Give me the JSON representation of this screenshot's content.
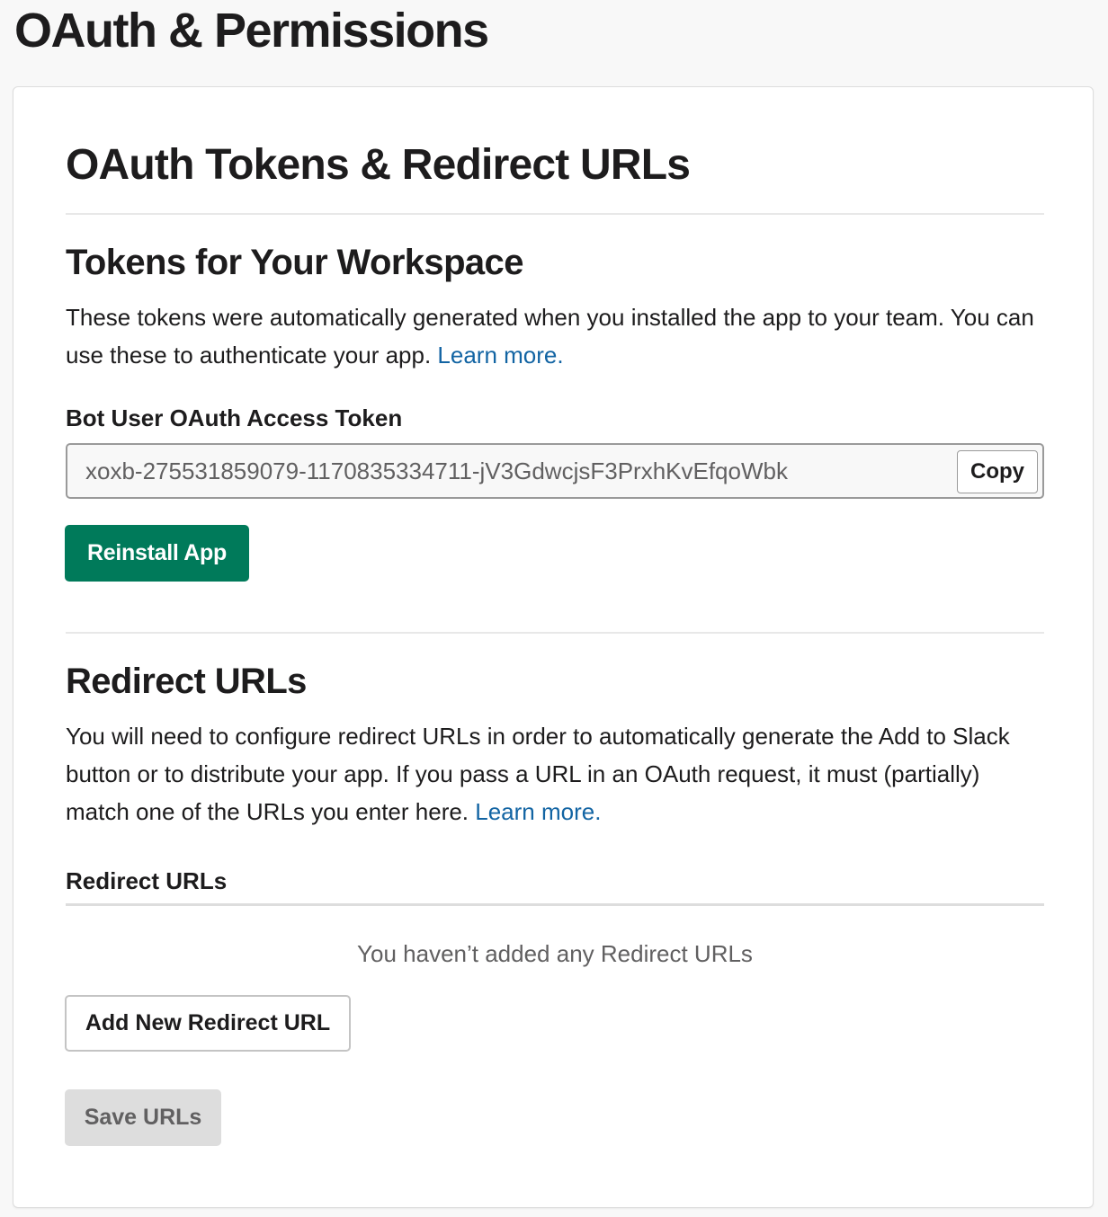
{
  "page": {
    "title": "OAuth & Permissions"
  },
  "oauth_section": {
    "title": "OAuth Tokens & Redirect URLs"
  },
  "tokens": {
    "title": "Tokens for Your Workspace",
    "description": "These tokens were automatically generated when you installed the app to your team. You can use these to authenticate your app.",
    "learn_more": "Learn more.",
    "bot_token_label": "Bot User OAuth Access Token",
    "bot_token_value": "xoxb-275531859079-1170835334711-jV3GdwcjsF3PrxhKvEfqoWbk",
    "copy_label": "Copy",
    "reinstall_label": "Reinstall App"
  },
  "redirects": {
    "title": "Redirect URLs",
    "description": "You will need to configure redirect URLs in order to automatically generate the Add to Slack button or to distribute your app. If you pass a URL in an OAuth request, it must (partially) match one of the URLs you enter here.",
    "learn_more": "Learn more.",
    "list_label": "Redirect URLs",
    "empty_text": "You haven’t added any Redirect URLs",
    "add_label": "Add New Redirect URL",
    "save_label": "Save URLs"
  },
  "colors": {
    "page_background": "#f8f8f8",
    "card_background": "#ffffff",
    "primary_button": "#007a5a",
    "link": "#1264a3",
    "disabled_button": "#dddddd"
  }
}
